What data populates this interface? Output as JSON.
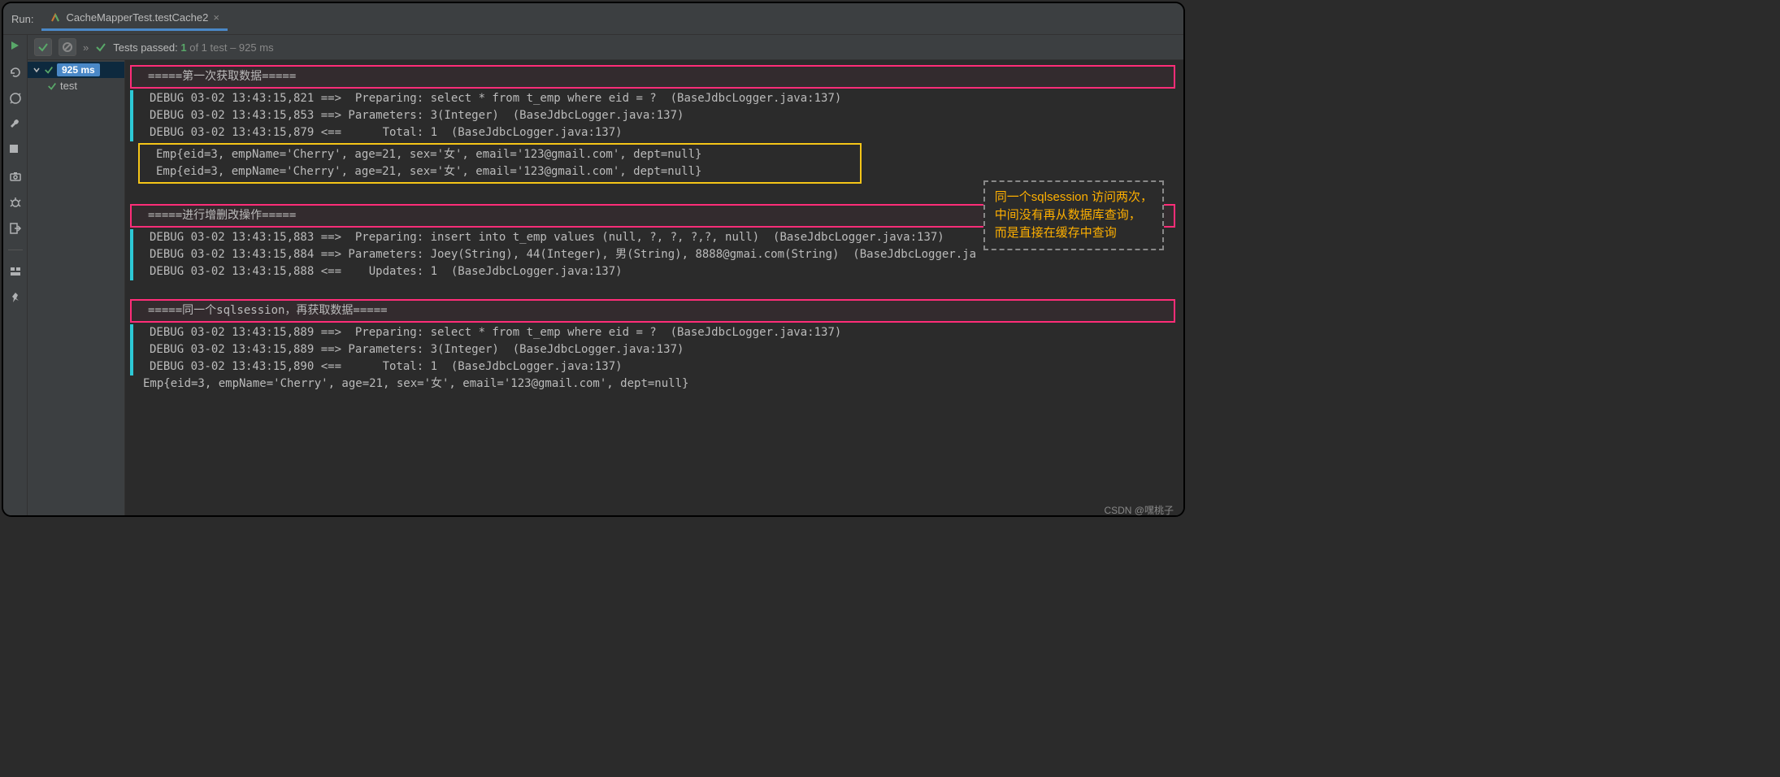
{
  "title_bar": {
    "label": "Run:"
  },
  "tab": {
    "title": "CacheMapperTest.testCache2"
  },
  "toolbar": {
    "tests_passed_prefix": "Tests passed:",
    "tests_passed_count": "1",
    "tests_total": "of 1 test",
    "duration": "– 925 ms"
  },
  "tree": {
    "root_time": "925 ms",
    "child_label": "test"
  },
  "sections": {
    "s1_header": "=====第一次获取数据=====",
    "s1_log": [
      "DEBUG 03-02 13:43:15,821 ==>  Preparing: select * from t_emp where eid = ?  (BaseJdbcLogger.java:137)",
      "DEBUG 03-02 13:43:15,853 ==> Parameters: 3(Integer)  (BaseJdbcLogger.java:137)",
      "DEBUG 03-02 13:43:15,879 <==      Total: 1  (BaseJdbcLogger.java:137)"
    ],
    "s1_emp": [
      "Emp{eid=3, empName='Cherry', age=21, sex='女', email='123@gmail.com', dept=null}",
      "Emp{eid=3, empName='Cherry', age=21, sex='女', email='123@gmail.com', dept=null}"
    ],
    "s2_header": "=====进行增删改操作=====",
    "s2_log": [
      "DEBUG 03-02 13:43:15,883 ==>  Preparing: insert into t_emp values (null, ?, ?, ?,?, null)  (BaseJdbcLogger.java:137)",
      "DEBUG 03-02 13:43:15,884 ==> Parameters: Joey(String), 44(Integer), 男(String), 8888@gmai.com(String)  (BaseJdbcLogger.ja",
      "DEBUG 03-02 13:43:15,888 <==    Updates: 1  (BaseJdbcLogger.java:137)"
    ],
    "s3_header": "=====同一个sqlsession，再获取数据=====",
    "s3_log": [
      "DEBUG 03-02 13:43:15,889 ==>  Preparing: select * from t_emp where eid = ?  (BaseJdbcLogger.java:137)",
      "DEBUG 03-02 13:43:15,889 ==> Parameters: 3(Integer)  (BaseJdbcLogger.java:137)",
      "DEBUG 03-02 13:43:15,890 <==      Total: 1  (BaseJdbcLogger.java:137)"
    ],
    "s3_emp": "Emp{eid=3, empName='Cherry', age=21, sex='女', email='123@gmail.com', dept=null}"
  },
  "annotation": {
    "line1": "同一个sqlsession 访问两次，",
    "line2": "中间没有再从数据库查询，",
    "line3": "而是直接在缓存中查询"
  },
  "watermark": "CSDN @嘿桃子"
}
